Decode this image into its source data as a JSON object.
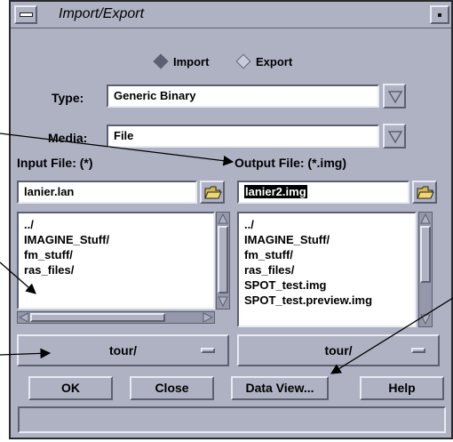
{
  "window": {
    "title": "Import/Export"
  },
  "mode": {
    "import_label": "Import",
    "export_label": "Export",
    "selected": "Import"
  },
  "type": {
    "label": "Type:",
    "value": "Generic Binary"
  },
  "media": {
    "label": "Media:",
    "value": "File"
  },
  "input": {
    "label": "Input File: (*)",
    "filename": "lanier.lan",
    "files": [
      "../",
      "IMAGINE_Stuff/",
      "fm_stuff/",
      "ras_files/"
    ],
    "directory": "tour/"
  },
  "output": {
    "label": "Output File: (*.img)",
    "filename": "lanier2.img",
    "files": [
      "../",
      "IMAGINE_Stuff/",
      "fm_stuff/",
      "ras_files/",
      "SPOT_test.img",
      "SPOT_test.preview.img"
    ],
    "directory": "tour/"
  },
  "buttons": {
    "ok": "OK",
    "close": "Close",
    "data_view": "Data View...",
    "help": "Help"
  },
  "status": ""
}
